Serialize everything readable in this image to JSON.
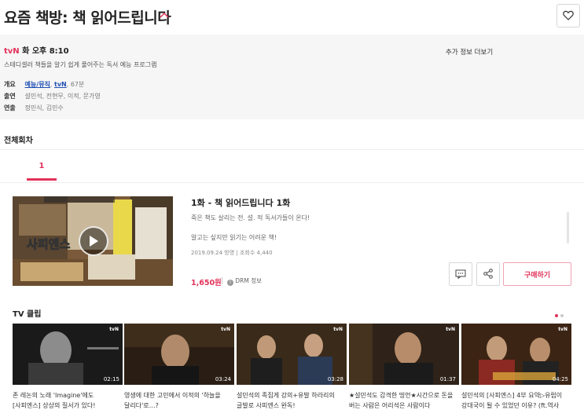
{
  "header": {
    "title": "요즘 책방: 책 읽어드립니다"
  },
  "info": {
    "channel": "tvN",
    "schedule": "화 오후 8:10",
    "description": "스테디셀러 책들을 알기 쉽게 풀어주는 독서 예능 프로그램",
    "more_info": "추가 정보 더보기",
    "overview_label": "개요",
    "genre": "예능/뮤직",
    "overview_channel": "tvN",
    "runtime": ", 67분",
    "cast_label": "출연",
    "cast": "설민석, 전현무, 이적, 문가영",
    "director_label": "연출",
    "directors": "정민식, 김민수"
  },
  "episodes_section": {
    "title": "전체회차",
    "tabs": [
      "1"
    ]
  },
  "episode": {
    "title": "1화 - 책 읽어드립니다 1화",
    "desc1": "죽은 책도 살리는 전. 설. 적 독서가들이 온다!",
    "desc2": "알고는 싶지만 읽기는 어려운 책!",
    "meta": "2019.09.24 방영 | 조회수 4,440",
    "price": "1,650원",
    "drm": "DRM 정보",
    "buy_label": "구매하기",
    "thumb_text": "사피엔스"
  },
  "clips_section": {
    "title": "TV 클립",
    "channel_mark": "tvN",
    "clips": [
      {
        "title": "존 레논의 노래 'Imagine'에도 [사피엔스] 상상의 질서가 있다!",
        "duration": "02:15"
      },
      {
        "title": "영생에 대한 고민에서 이적의 '하늘을 달리다'로…?",
        "duration": "03:24"
      },
      {
        "title": "설민석의 족집게 강의+유발 하라리의 글발로 사피엔스 완독!",
        "duration": "03:28"
      },
      {
        "title": "★설민석도 감격한 띵언★시간으로 돈을 버는 사람은 어리석은 사람이다",
        "duration": "01:37"
      },
      {
        "title": "설민석의 [사피엔스] 4부 요약▷유럽이 강대국이 될 수 있었던 이유? (ft.역사 라이…",
        "duration": "04:25"
      }
    ]
  },
  "colors": {
    "accent": "#e2325a",
    "link": "#1f4fb3"
  }
}
